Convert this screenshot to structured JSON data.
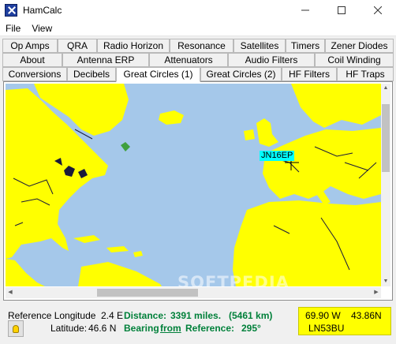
{
  "window": {
    "title": "HamCalc",
    "controls": {
      "minimize": "—",
      "maximize": "☐",
      "close": "✕"
    }
  },
  "menu": [
    "File",
    "View"
  ],
  "tabs": {
    "row1": [
      "Op Amps",
      "QRA",
      "Radio Horizon",
      "Resonance",
      "Satellites",
      "Timers",
      "Zener Diodes"
    ],
    "row2": [
      "About",
      "Antenna ERP",
      "Attenuators",
      "Audio Filters",
      "Coil Winding"
    ],
    "row3": [
      "Conversions",
      "Decibels",
      "Great Circles (1)",
      "Great Circles (2)",
      "HF Filters",
      "HF Traps"
    ],
    "active": "Great Circles (1)"
  },
  "map": {
    "locator_label": "JN16EP",
    "colors": {
      "land": "#ffff00",
      "water": "#a5c8ea",
      "rivers": "#1a1a3a",
      "locator_bg": "#00ffff"
    },
    "watermark": "SOFTPEDIA"
  },
  "status": {
    "ref_longitude_label": "Reference Longitude",
    "ref_longitude_value": "2.4 E",
    "latitude_label": "Latitude:",
    "latitude_value": "46.6 N",
    "distance_label": "Distance:",
    "distance_miles": "3391 miles.",
    "distance_km": "(5461 km)",
    "bearing_prefix": "Bearing",
    "bearing_from": "from",
    "bearing_suffix": "Reference:",
    "bearing_value": "295°",
    "cursor_lon": "69.90 W",
    "cursor_lat": "43.86N",
    "cursor_grid": "LN53BU",
    "accent_green": "#00803a",
    "info_bg": "#ffff00"
  },
  "icons": {
    "app": "hamcalc-app-icon",
    "help": "lightbulb-icon"
  }
}
